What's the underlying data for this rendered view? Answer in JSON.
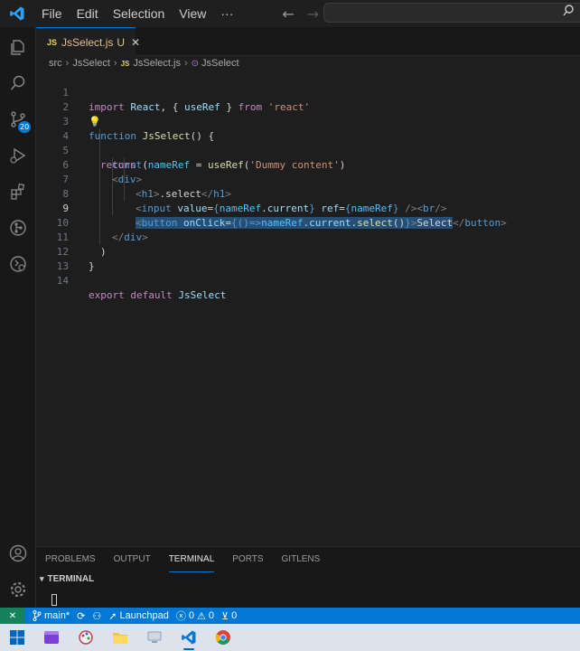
{
  "menu": {
    "file": "File",
    "edit": "Edit",
    "selection": "Selection",
    "view": "View",
    "more": "···"
  },
  "tab": {
    "lang_badge": "JS",
    "filename": "JsSelect.js",
    "status": "U"
  },
  "breadcrumb": {
    "folder1": "src",
    "folder2": "JsSelect",
    "file_badge": "JS",
    "file": "JsSelect.js",
    "symbol": "JsSelect"
  },
  "activity": {
    "scm_badge": "20"
  },
  "code": {
    "line_numbers": [
      "1",
      "2",
      "3",
      "4",
      "5",
      "6",
      "7",
      "8",
      "9",
      "10",
      "11",
      "12",
      "13",
      "14"
    ],
    "l1": {
      "import": "import",
      "react": "React",
      "brace_open": ", { ",
      "useRef": "useRef",
      "brace_close": " } ",
      "from": "from",
      "module": "'react'"
    },
    "l3": {
      "function": "function",
      "name": "JsSelect",
      "paren": "() {"
    },
    "l4": {
      "const": "const",
      "nameRef": "nameRef",
      "eq": " = ",
      "useRef": "useRef",
      "p1": "(",
      "str": "'Dummy content'",
      "p2": ")"
    },
    "l5": {
      "return": "return",
      "paren": " ("
    },
    "l6": {
      "open": "<",
      "tag": "div",
      "close": ">"
    },
    "l7": {
      "open": "<",
      "tag": "h1",
      "close": ">",
      "text": ".select",
      "end_open": "</",
      "end_tag": "h1",
      "end_close": ">"
    },
    "l8": {
      "open": "<",
      "tag": "input",
      "attr1": "value",
      "eq1": "=",
      "expr1a": "{",
      "expr1b": "nameRef",
      "expr1c": ".",
      "expr1d": "current",
      "expr1e": "}",
      "attr2": "ref",
      "eq2": "=",
      "expr2a": "{",
      "expr2b": "nameRef",
      "expr2c": "}",
      "self_close": " />",
      "br_open": "<",
      "br_tag": "br",
      "br_close": "/>"
    },
    "l9": {
      "open": "<",
      "tag": "button",
      "attr": "onClick",
      "eq": "=",
      "b1": "{",
      "arrow": "()=>",
      "obj": "nameRef",
      "dot1": ".",
      "prop": "current",
      "dot2": ".",
      "method": "select",
      "call": "()",
      "b2": "}",
      "gt": ">",
      "text": "Select",
      "end_open": "</",
      "end_tag": "button",
      "end_close": ">"
    },
    "l10": {
      "open": "</",
      "tag": "div",
      "close": ">"
    },
    "l11": {
      "paren": ")"
    },
    "l12": {
      "brace": "}"
    },
    "l14": {
      "export": "export",
      "default": "default",
      "name": "JsSelect"
    }
  },
  "panel": {
    "tabs": [
      "PROBLEMS",
      "OUTPUT",
      "TERMINAL",
      "PORTS",
      "GITLENS"
    ],
    "section": "TERMINAL"
  },
  "status": {
    "branch": "main*",
    "launchpad": "Launchpad",
    "errors": "0",
    "warnings": "0",
    "ports": "0"
  },
  "colors": {
    "accent": "#0078d4",
    "statusbar": "#0078d4",
    "remote": "#16825d",
    "selection": "#264f78"
  }
}
